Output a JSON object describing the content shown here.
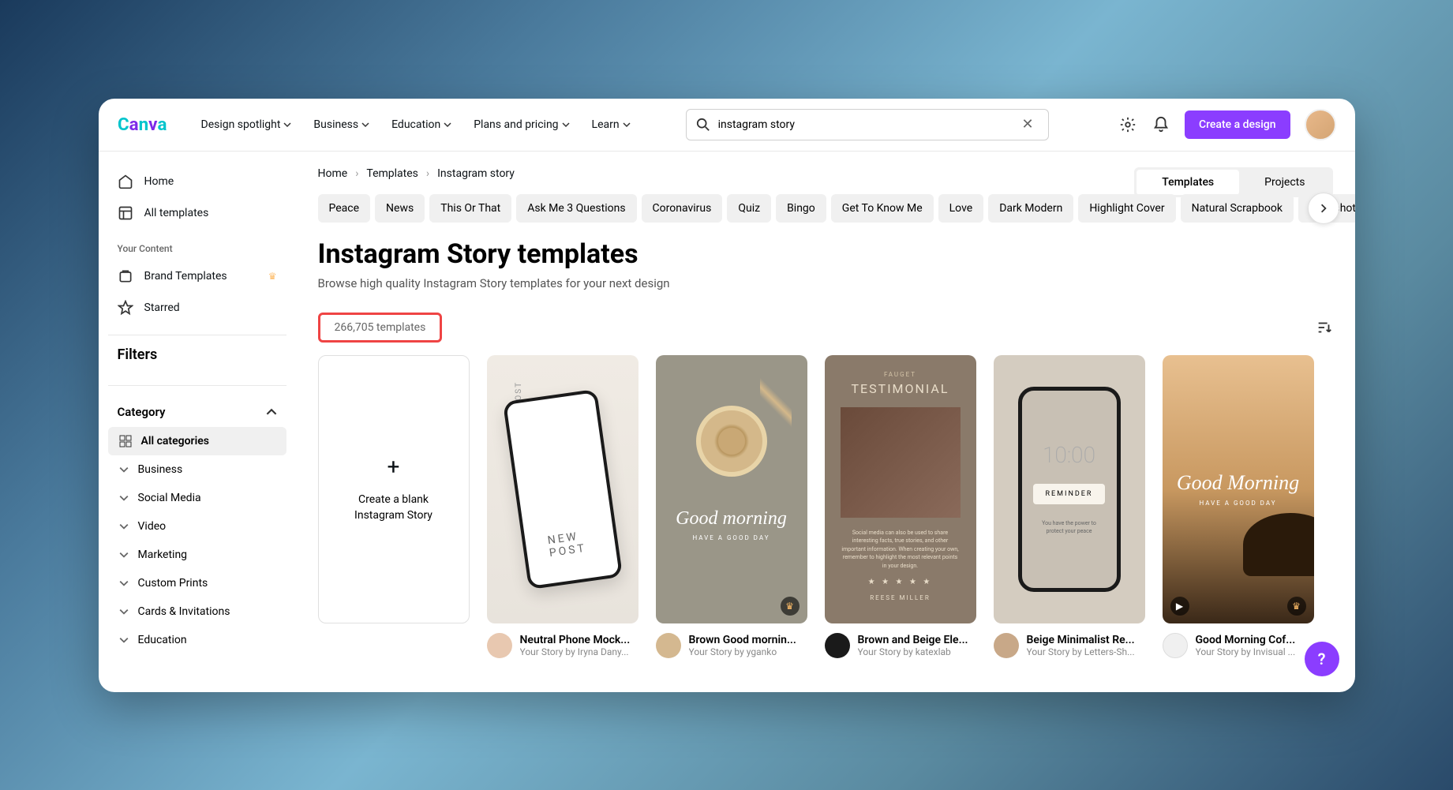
{
  "header": {
    "nav": [
      "Design spotlight",
      "Business",
      "Education",
      "Plans and pricing",
      "Learn"
    ],
    "search_value": "instagram story",
    "create_label": "Create a design"
  },
  "sidebar": {
    "home": "Home",
    "all_templates": "All templates",
    "your_content_label": "Your Content",
    "brand_templates": "Brand Templates",
    "starred": "Starred",
    "filters_title": "Filters",
    "category_label": "Category",
    "categories": [
      "All categories",
      "Business",
      "Social Media",
      "Video",
      "Marketing",
      "Custom Prints",
      "Cards & Invitations",
      "Education"
    ]
  },
  "breadcrumb": [
    "Home",
    "Templates",
    "Instagram story"
  ],
  "toggle": {
    "templates": "Templates",
    "projects": "Projects"
  },
  "chips": [
    "Peace",
    "News",
    "This Or That",
    "Ask Me 3 Questions",
    "Coronavirus",
    "Quiz",
    "Bingo",
    "Get To Know Me",
    "Love",
    "Dark Modern",
    "Highlight Cover",
    "Natural Scrapbook",
    "Snapshot"
  ],
  "page": {
    "title": "Instagram Story templates",
    "subtitle": "Browse high quality Instagram Story templates for your next design",
    "count": "266,705 templates"
  },
  "blank_card": {
    "line1": "Create a blank",
    "line2": "Instagram Story"
  },
  "cards": [
    {
      "title": "Neutral Phone Mock...",
      "author": "Your Story by Iryna Dany...",
      "avatar_bg": "#e8c8b0"
    },
    {
      "title": "Brown Good mornin...",
      "author": "Your Story by yganko",
      "avatar_bg": "#d4b890",
      "premium": true
    },
    {
      "title": "Brown and Beige Ele...",
      "author": "Your Story by katexlab",
      "avatar_bg": "#1a1a1a"
    },
    {
      "title": "Beige Minimalist Re...",
      "author": "Your Story by Letters-Sh...",
      "avatar_bg": "#c8a888"
    },
    {
      "title": "Good Morning Cof...",
      "author": "Your Story by Invisual ...",
      "avatar_bg": "#f0f0f0",
      "premium": true,
      "video": true
    }
  ]
}
